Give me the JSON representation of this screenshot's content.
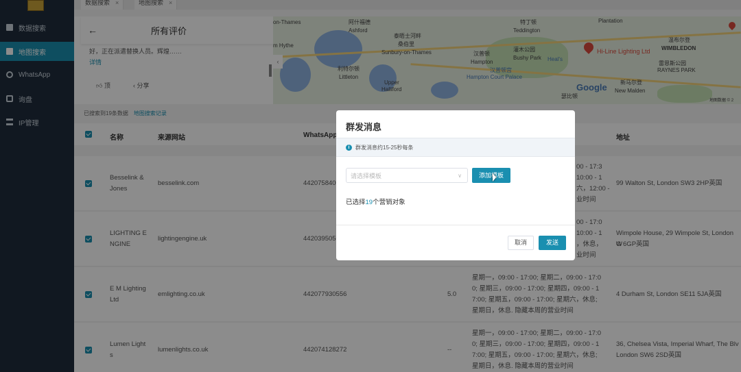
{
  "sidebar": {
    "items": [
      {
        "label": "数据搜索",
        "icon": "search-data-icon",
        "active": false
      },
      {
        "label": "地图搜索",
        "icon": "map-icon",
        "active": true
      },
      {
        "label": "WhatsApp",
        "icon": "whatsapp-icon",
        "active": false
      },
      {
        "label": "询盘",
        "icon": "inquiry-icon",
        "active": false
      },
      {
        "label": "IP管理",
        "icon": "ip-icon",
        "active": false
      }
    ]
  },
  "tabs": [
    {
      "label": "数据搜索",
      "close": "×"
    },
    {
      "label": "地图搜索",
      "close": "×"
    }
  ],
  "review": {
    "back": "←",
    "title": "所有评价",
    "text": "好，正在派遣替换人员。辉煌……",
    "more": "详情",
    "like_label": "顶",
    "share_label": "分享"
  },
  "map": {
    "labels": {
      "thames": "on-Thames",
      "ashford_cn": "阿什福德",
      "ashford": "Ashford",
      "sunbury_cn": "泰晤士河畔",
      "sunbury_cn2": "桑伯里",
      "sunbury": "Sunbury-on-Thames",
      "teddington_cn": "特丁顿",
      "teddington": "Teddington",
      "hythe": "m Hythe",
      "littleton_cn": "利特尔顿",
      "littleton": "Littleton",
      "upper_cn": "Upper",
      "halliford": "Halliford",
      "hampton_cn": "汉普顿",
      "hampton": "Hampton",
      "park_cn": "灌木公园",
      "park": "Bushy Park",
      "hcp_cn": "汉普顿宫",
      "hcp": "Hampton Court Palace",
      "heals": "Heal's",
      "hiline": "Hi-Line Lighting Ltd",
      "wimbledon_cn": "温布尔登",
      "wimbledon": "WIMBLEDON",
      "raynes_cn": "雷恩斯公园",
      "raynes": "RAYNES PARK",
      "newmalden_cn": "新马尔登",
      "newmalden": "New Malden",
      "surbiton": "瑟比顿",
      "plantation": "Plantation",
      "google": "Google",
      "copyright": "地图数据 © 2"
    },
    "handle": "‹"
  },
  "results": {
    "count_text": "已搜索到19条数据",
    "record_link": "地图搜索记录"
  },
  "table": {
    "headers": {
      "name": "名称",
      "source": "来源网站",
      "whatsapp": "WhatsApp",
      "address": "地址"
    },
    "rows": [
      {
        "name1": "Besselink &",
        "name2": "Jones",
        "site": "besselink.com",
        "phone": "4420758400",
        "rating": "",
        "hours": [
          "00 - 17:3",
          "10:00 - 1",
          "六，12:00 -",
          "业时间"
        ],
        "addr1": "99 Walton St, London SW3 2HP英国",
        "addr2": ""
      },
      {
        "name1": "LIGHTING E",
        "name2": "NGINE",
        "site": "lightingengine.uk",
        "phone": "4420395050",
        "rating": "",
        "hours": [
          "00 - 17:0",
          "10:00 - 1",
          "，休息，",
          "业时间"
        ],
        "addr1": "Wimpole House, 29 Wimpole St, London W",
        "addr2": "G 6GP英国"
      },
      {
        "name1": "E M Lighting",
        "name2": "Ltd",
        "site": "emlighting.co.uk",
        "phone": "442077930556",
        "rating": "5.0",
        "hours": [
          "星期一，09:00 - 17:00; 星期二，09:00 - 17:0",
          "0; 星期三，09:00 - 17:00; 星期四，09:00 - 1",
          "7:00; 星期五，09:00 - 17:00; 星期六，休息;",
          "星期日，休息. 隐藏本周的营业时间"
        ],
        "addr1": "4 Durham St, London SE11 5JA英国",
        "addr2": ""
      },
      {
        "name1": "Lumen Light",
        "name2": "s",
        "site": "lumenlights.co.uk",
        "phone": "442074128272",
        "rating": "--",
        "hours": [
          "星期一，09:00 - 17:00; 星期二，09:00 - 17:0",
          "0; 星期三，09:00 - 17:00; 星期四，09:00 - 1",
          "7:00; 星期五，09:00 - 17:00; 星期六，休息;",
          "星期日，休息. 隐藏本周的营业时间"
        ],
        "addr1": "36, Chelsea Vista, Imperial Wharf, The Blv",
        "addr2": "London SW6 2SD英国"
      }
    ]
  },
  "modal": {
    "title": "群发消息",
    "notice": "群发消息约15-25秒每条",
    "template_placeholder": "请选择模板",
    "add_template": "添加模板",
    "selected_prefix": "已选择",
    "selected_count": "19",
    "selected_suffix": "个营销对象",
    "cancel": "取消",
    "send": "发送"
  },
  "colors": {
    "accent": "#1a8fb0",
    "sidebar_bg": "#1f2d3d",
    "pin": "#d9493c"
  }
}
